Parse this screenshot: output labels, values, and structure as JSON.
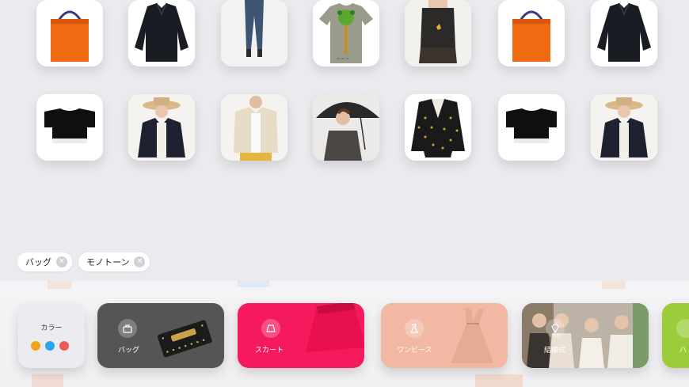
{
  "grid": {
    "row1": [
      "orange-tote-bag",
      "black-shirt",
      "jeans",
      "green-tree-tshirt",
      "black-lace-top",
      "orange-tote-bag",
      "black-shirt"
    ],
    "row2": [
      "black-cropped-tee",
      "hat-cardigan-woman",
      "beige-jacket-woman",
      "umbrella-woman",
      "black-dotted-cardigan",
      "black-cropped-tee",
      "hat-cardigan-woman"
    ]
  },
  "filters": {
    "chips": [
      {
        "label": "バッグ"
      },
      {
        "label": "モノトーン"
      }
    ]
  },
  "categories": {
    "color": {
      "label": "カラー",
      "dots": [
        "#f4a11f",
        "#2aa6ea",
        "#ec5a5a"
      ]
    },
    "items": [
      {
        "label": "バッグ",
        "bg": "#555555",
        "icon": "bag-icon"
      },
      {
        "label": "スカート",
        "bg": "#f5195e",
        "icon": "skirt-icon"
      },
      {
        "label": "ワンピース",
        "bg": "#f1b9a4",
        "icon": "dress-icon"
      },
      {
        "label": "結婚式",
        "bg": "#a89b8e",
        "icon": "diamond-icon"
      },
      {
        "label": "ハ",
        "bg": "#9ccc3a",
        "icon": "partial-icon"
      }
    ]
  }
}
